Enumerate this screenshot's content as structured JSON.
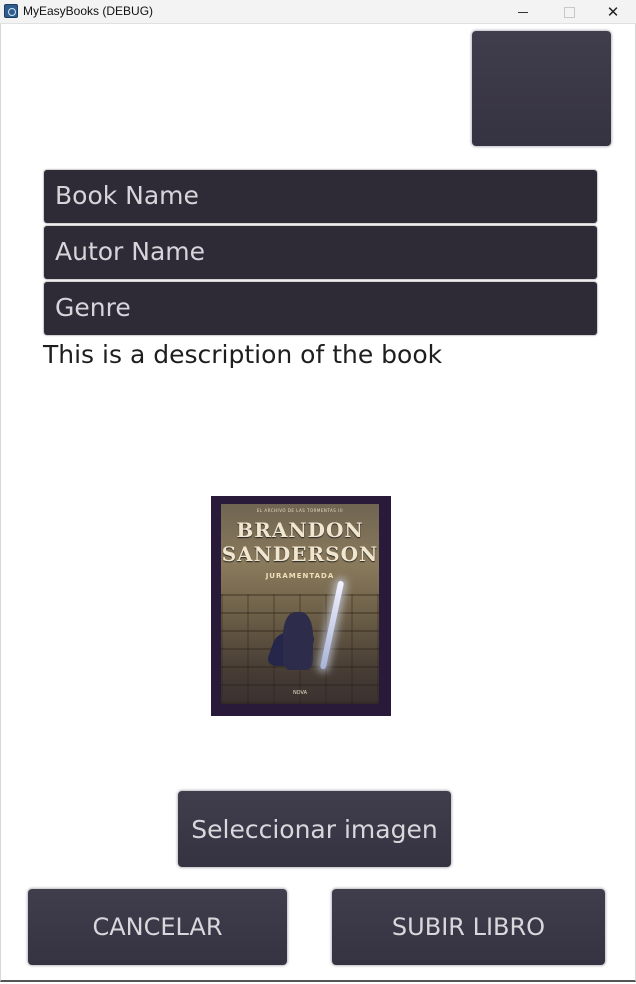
{
  "window": {
    "title": "MyEasyBooks (DEBUG)",
    "minimize": "—",
    "maximize": "☐",
    "close": "✕"
  },
  "form": {
    "book_name": "Book Name",
    "author_name": "Autor Name",
    "genre": "Genre",
    "description": "This is a description of the book"
  },
  "cover": {
    "top_line": "EL ARCHIVO DE LAS TORMENTAS III",
    "author_line1": "BRANDON",
    "author_line2": "SANDERSON",
    "title": "JURAMENTADA",
    "publisher": "NOVA"
  },
  "buttons": {
    "top_action": "",
    "select_image": "Seleccionar imagen",
    "cancel": "CANCELAR",
    "upload": "SUBIR LIBRO"
  },
  "colors": {
    "button_bg": "#3b3847",
    "field_bg": "#2e2b37",
    "button_text": "#d8d8dc"
  }
}
